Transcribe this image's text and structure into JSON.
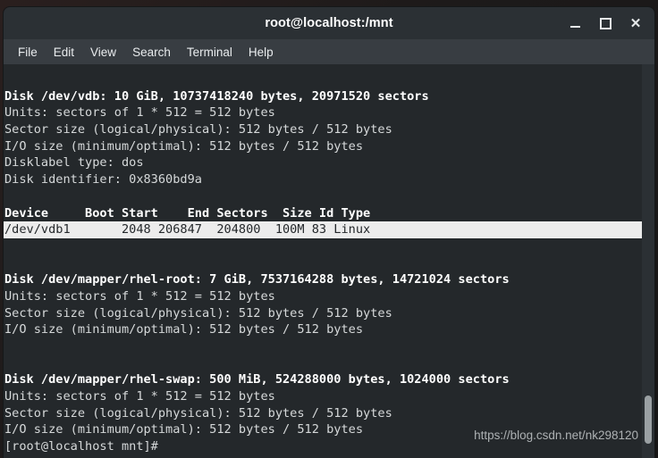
{
  "window": {
    "title": "root@localhost:/mnt",
    "controls": [
      {
        "name": "minimize",
        "label": "—"
      },
      {
        "name": "maximize",
        "label": "□"
      },
      {
        "name": "close",
        "label": "✕"
      }
    ]
  },
  "menubar": {
    "items": [
      {
        "label": "File"
      },
      {
        "label": "Edit"
      },
      {
        "label": "View"
      },
      {
        "label": "Search"
      },
      {
        "label": "Terminal"
      },
      {
        "label": "Help"
      }
    ]
  },
  "terminal": {
    "colors": {
      "background": "#24282b",
      "foreground": "#d6d9da",
      "bold_foreground": "#ffffff",
      "highlight_background": "#ececec",
      "highlight_foreground": "#24282b",
      "titlebar": "#2b3034",
      "menubar": "#383d42",
      "scrollbar_thumb": "#9aa0a3"
    },
    "lines": [
      {
        "text": "",
        "style": "normal"
      },
      {
        "text": "Disk /dev/vdb: 10 GiB, 10737418240 bytes, 20971520 sectors",
        "style": "bold"
      },
      {
        "text": "Units: sectors of 1 * 512 = 512 bytes",
        "style": "normal"
      },
      {
        "text": "Sector size (logical/physical): 512 bytes / 512 bytes",
        "style": "normal"
      },
      {
        "text": "I/O size (minimum/optimal): 512 bytes / 512 bytes",
        "style": "normal"
      },
      {
        "text": "Disklabel type: dos",
        "style": "normal"
      },
      {
        "text": "Disk identifier: 0x8360bd9a",
        "style": "normal"
      },
      {
        "text": "",
        "style": "normal"
      },
      {
        "text": "Device     Boot Start    End Sectors  Size Id Type",
        "style": "bold"
      },
      {
        "text": "/dev/vdb1       2048 206847  204800  100M 83 Linux",
        "style": "highlight"
      },
      {
        "text": "",
        "style": "normal"
      },
      {
        "text": "",
        "style": "normal"
      },
      {
        "text": "Disk /dev/mapper/rhel-root: 7 GiB, 7537164288 bytes, 14721024 sectors",
        "style": "bold"
      },
      {
        "text": "Units: sectors of 1 * 512 = 512 bytes",
        "style": "normal"
      },
      {
        "text": "Sector size (logical/physical): 512 bytes / 512 bytes",
        "style": "normal"
      },
      {
        "text": "I/O size (minimum/optimal): 512 bytes / 512 bytes",
        "style": "normal"
      },
      {
        "text": "",
        "style": "normal"
      },
      {
        "text": "",
        "style": "normal"
      },
      {
        "text": "Disk /dev/mapper/rhel-swap: 500 MiB, 524288000 bytes, 1024000 sectors",
        "style": "bold"
      },
      {
        "text": "Units: sectors of 1 * 512 = 512 bytes",
        "style": "normal"
      },
      {
        "text": "Sector size (logical/physical): 512 bytes / 512 bytes",
        "style": "normal"
      },
      {
        "text": "I/O size (minimum/optimal): 512 bytes / 512 bytes",
        "style": "normal"
      },
      {
        "text": "[root@localhost mnt]#",
        "style": "normal"
      }
    ]
  },
  "watermark": {
    "text": "https://blog.csdn.net/nk298120"
  }
}
